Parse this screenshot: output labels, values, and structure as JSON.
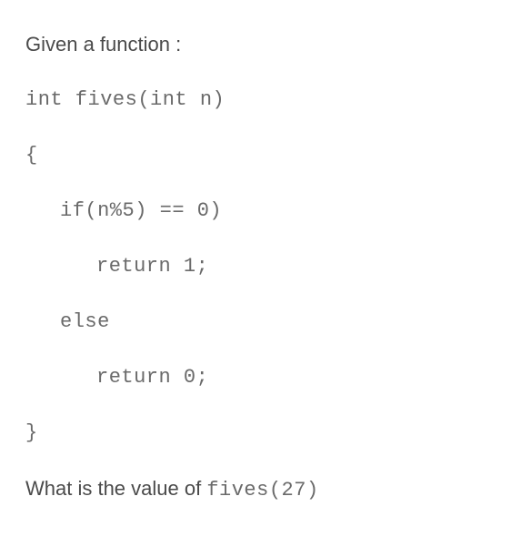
{
  "intro": "Given a function :",
  "code": {
    "signature": "int fives(int n)",
    "open_brace": "{",
    "if_line": "if(n%5) == 0)",
    "return1": "return 1;",
    "else_line": "else",
    "return0": "return 0;",
    "close_brace": "}"
  },
  "question_prefix": "What is the value of ",
  "question_code": "fives(27)"
}
